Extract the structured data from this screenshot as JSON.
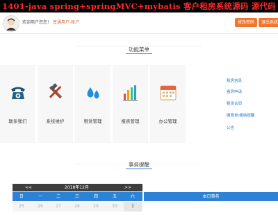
{
  "banner": {
    "text": "1401-java spring+springMVC+mybatis 客户租房系统源码 源代码"
  },
  "header": {
    "welcome_prefix": "欢迎用户您您！",
    "role_label": "普通用户-账户",
    "buttons": [
      "修改密码",
      "退出系统"
    ]
  },
  "sections": {
    "menu_title": "功能菜单",
    "notice_title": "事务提醒"
  },
  "menu": {
    "items": [
      {
        "label": "联系我们",
        "icon": "telephone-icon"
      },
      {
        "label": "系统维护",
        "icon": "tools-icon"
      },
      {
        "label": "租赁管理",
        "icon": "water-drops-icon"
      },
      {
        "label": "报表管理",
        "icon": "bar-chart-icon"
      },
      {
        "label": "办公管理",
        "icon": "calendar-icon"
      }
    ]
  },
  "notices": [
    "租房信息",
    "看房申请",
    "租赁合同",
    "缴费单/缴纳提醒",
    "公告"
  ],
  "calendar": {
    "prev": "<<",
    "title": "2018年12月",
    "next": ">>",
    "weekdays": [
      "日",
      "一",
      "二",
      "三",
      "四",
      "五",
      "六"
    ],
    "days": [
      "25",
      "26",
      "27",
      "28",
      "29",
      "30",
      "1"
    ],
    "today_index": 6,
    "side_label": "本日事务"
  },
  "colors": {
    "accent": "#f0762f",
    "primary": "#2e82d6",
    "banner_text": "#ff2a2a"
  }
}
